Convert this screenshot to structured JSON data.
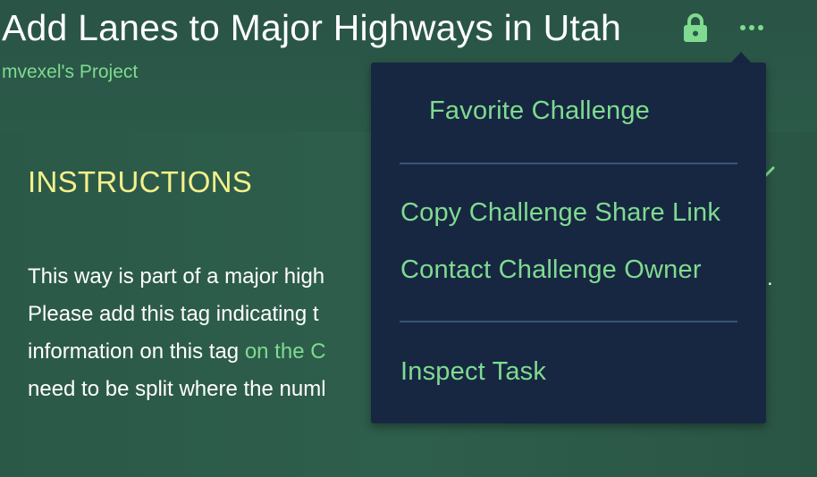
{
  "header": {
    "title": "Add Lanes to Major Highways in Utah",
    "subtitle": "mvexel's Project",
    "lock_icon": "lock-icon",
    "more_icon": "ellipsis-icon"
  },
  "instructions": {
    "heading": "INSTRUCTIONS",
    "lines": [
      "This way is part of a major high",
      "Please add this tag indicating t",
      "information on this tag ",
      "need to be split where the numl"
    ],
    "link_text": "on the C",
    "trailing_visible": "."
  },
  "menu": {
    "items": [
      "Favorite Challenge",
      "Copy Challenge Share Link",
      "Contact Challenge Owner",
      "Inspect Task"
    ]
  },
  "colors": {
    "background": "#2b5948",
    "menu_bg": "#172742",
    "accent_green": "#7fdb8f",
    "heading_yellow": "#f5f08a",
    "divider": "#3a5474"
  }
}
